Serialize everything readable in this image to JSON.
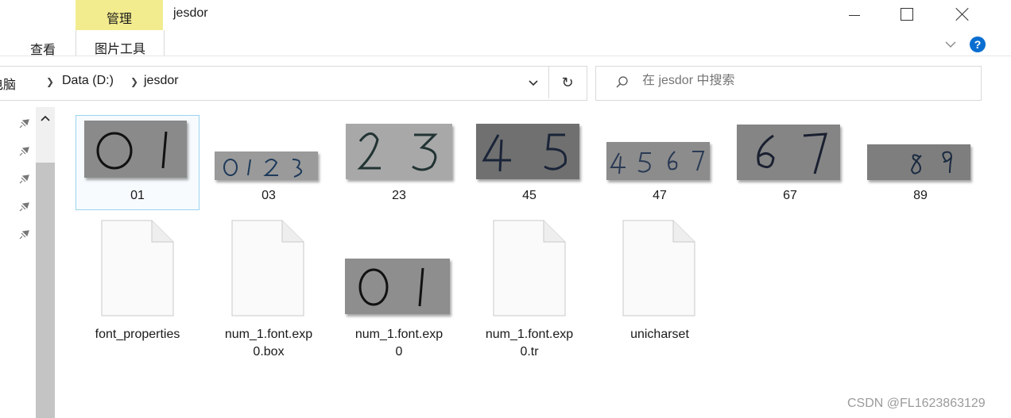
{
  "ribbon": {
    "contextual_group": "管理",
    "contextual_tab": "图片工具",
    "view_tab": "查看",
    "window_title": "jesdor"
  },
  "address": {
    "crumbs": [
      "电脑",
      "Data (D:)",
      "jesdor"
    ],
    "refresh_icon": "refresh-icon"
  },
  "search": {
    "placeholder": "在 jesdor 中搜索"
  },
  "files": [
    {
      "name": "01",
      "type": "image",
      "digits": "0 1"
    },
    {
      "name": "03",
      "type": "image",
      "digits": "0 1 2 3"
    },
    {
      "name": "23",
      "type": "image",
      "digits": "2 3"
    },
    {
      "name": "45",
      "type": "image",
      "digits": "4 5"
    },
    {
      "name": "47",
      "type": "image",
      "digits": "4 5 6 7"
    },
    {
      "name": "67",
      "type": "image",
      "digits": "6 7"
    },
    {
      "name": "89",
      "type": "image",
      "digits": "8 9"
    },
    {
      "name": "font_properties",
      "type": "file"
    },
    {
      "name_line1": "num_1.font.exp",
      "name_line2": "0.box",
      "type": "file"
    },
    {
      "name_line1": "num_1.font.exp",
      "name_line2": "0",
      "type": "image",
      "digits": "0 1"
    },
    {
      "name_line1": "num_1.font.exp",
      "name_line2": "0.tr",
      "type": "file"
    },
    {
      "name": "unicharset",
      "type": "file"
    }
  ],
  "watermark": "CSDN @FL1623863129"
}
